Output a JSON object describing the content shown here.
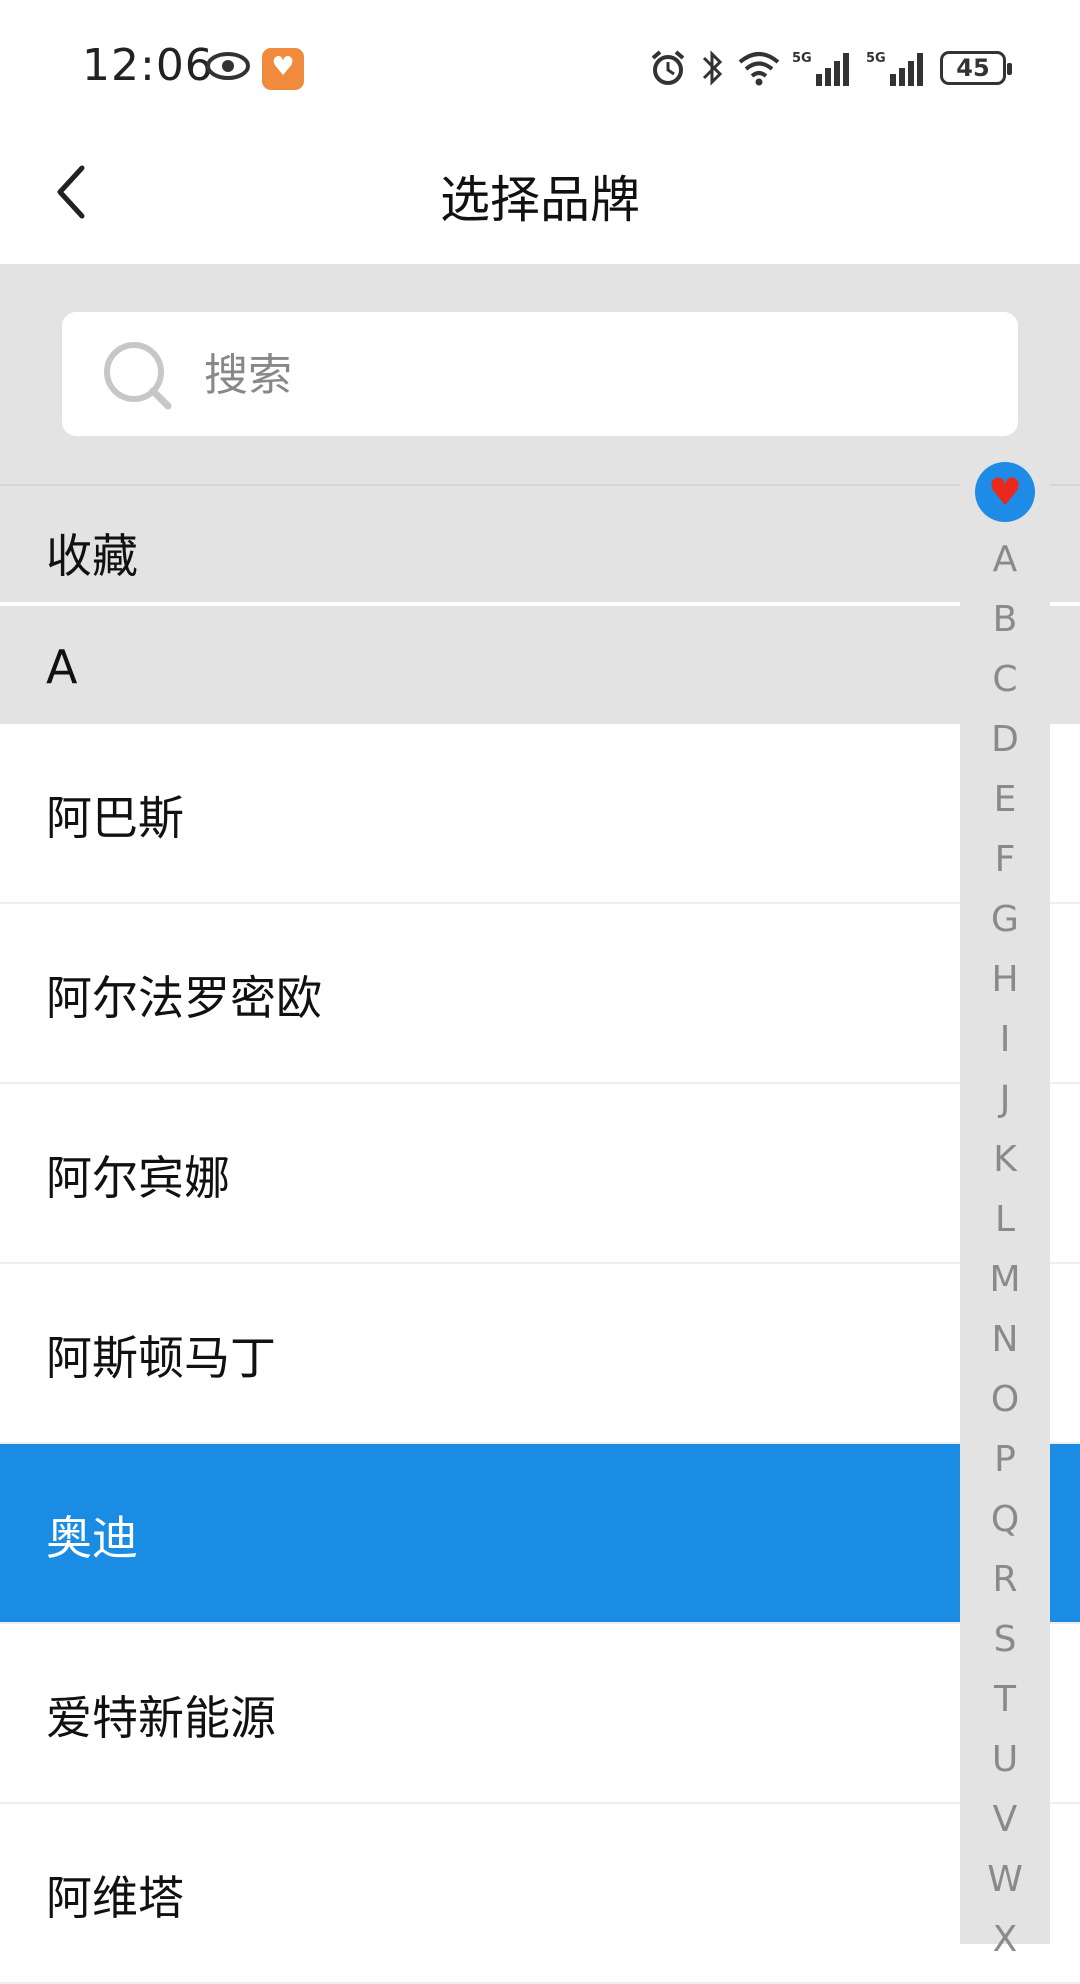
{
  "status_bar": {
    "time": "12:06",
    "battery": "45",
    "icons": [
      "eye-icon",
      "app-notification-icon",
      "alarm-icon",
      "bluetooth-icon",
      "wifi-icon",
      "signal-5g-icon",
      "signal-5g-icon",
      "battery-icon"
    ],
    "signal_labels": [
      "5G",
      "5G"
    ]
  },
  "header": {
    "back_icon": "chevron-left-icon",
    "title": "选择品牌"
  },
  "search": {
    "placeholder": "搜索",
    "value": "",
    "icon": "search-icon"
  },
  "sections": {
    "favorites_label": "收藏",
    "current_letter": "A"
  },
  "brands": [
    {
      "label": "阿巴斯",
      "selected": false
    },
    {
      "label": "阿尔法罗密欧",
      "selected": false
    },
    {
      "label": "阿尔宾娜",
      "selected": false
    },
    {
      "label": "阿斯顿马丁",
      "selected": false
    },
    {
      "label": "奥迪",
      "selected": true
    },
    {
      "label": "爱特新能源",
      "selected": false
    },
    {
      "label": "阿维塔",
      "selected": false
    }
  ],
  "index_bar": {
    "favorite_icon": "heart-icon",
    "letters": [
      "A",
      "B",
      "C",
      "D",
      "E",
      "F",
      "G",
      "H",
      "I",
      "J",
      "K",
      "L",
      "M",
      "N",
      "O",
      "P",
      "Q",
      "R",
      "S",
      "T",
      "U",
      "V",
      "W",
      "X"
    ]
  },
  "colors": {
    "accent": "#1b8ce3",
    "section_bg": "#e3e3e3",
    "index_text": "#8a8a8a",
    "heart": "#e8291c"
  }
}
